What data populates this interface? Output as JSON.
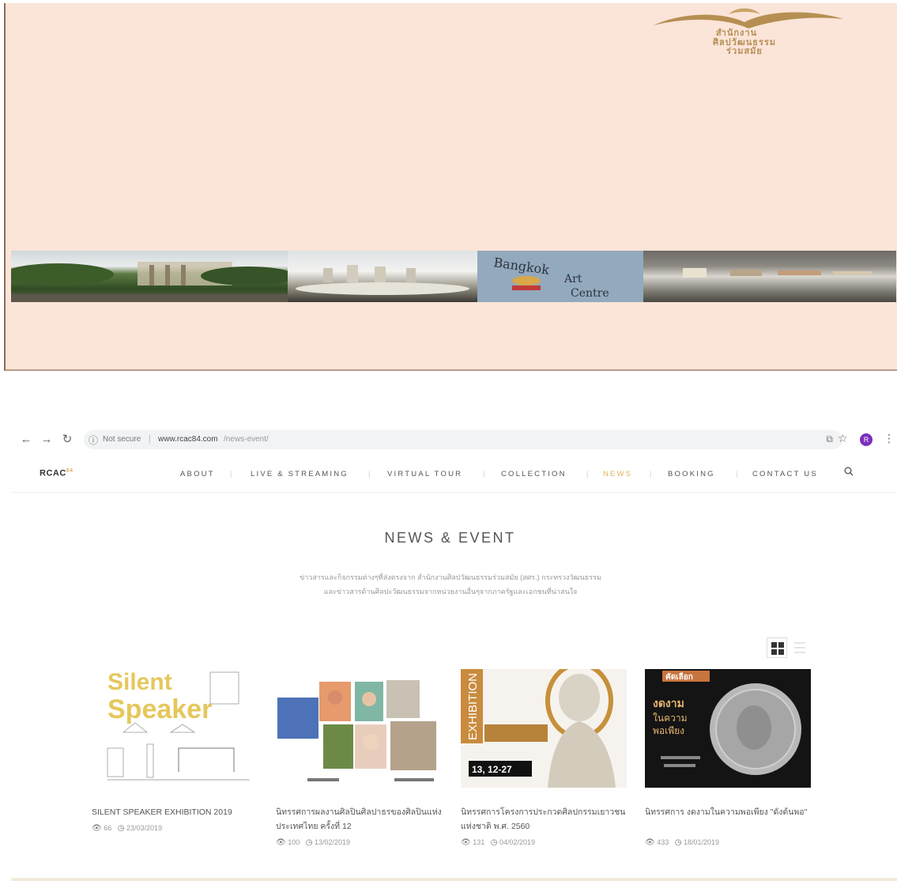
{
  "banner": {
    "logo_lines": [
      "สำนักงาน",
      "ศิลปวัฒนธรรม",
      "ร่วมสมัย"
    ],
    "logo_color": "#b58f52",
    "background": "#fbe4d8"
  },
  "browser": {
    "security": "Not secure",
    "url_domain": "www.rcac84.com",
    "url_path": "/news-event/",
    "profile_initial": "R",
    "icons": [
      "back-icon",
      "forward-icon",
      "reload-icon",
      "info-icon",
      "translate-icon",
      "star-icon",
      "kebab-icon"
    ]
  },
  "site": {
    "brand": "RCAC",
    "brand_sup": "84",
    "menu": [
      "ABOUT",
      "LIVE & STREAMING",
      "VIRTUAL TOUR",
      "COLLECTION",
      "NEWS",
      "BOOKING",
      "CONTACT US"
    ],
    "active_menu": "NEWS",
    "accent": "#e0b35a"
  },
  "page": {
    "title": "NEWS & EVENT",
    "intro_lines": [
      "ข่าวสารและกิจกรรมต่างๆที่ส่งตรงจาก สำนักงานศิลปวัฒนธรรมร่วมสมัย (สศร.) กระทรวงวัฒนธรรม",
      "และข่าวสารด้านศิลปะวัฒนธรรมจากหน่วยงานอื่นๆจากภาครัฐและเอกชนที่น่าสนใจ"
    ]
  },
  "cards": [
    {
      "title": "SILENT SPEAKER EXHIBITION 2019",
      "views": "66",
      "date": "23/03/2019"
    },
    {
      "title": "นิทรรศการผลงานศิลปินศิลปาธรของศิลปินแห่งประเทศไทย ครั้งที่ 12",
      "views": "100",
      "date": "13/02/2019"
    },
    {
      "title": "นิทรรศการโครงการประกวดศิลปกรรมเยาวชนแห่งชาติ พ.ศ. 2560",
      "views": "131",
      "date": "04/02/2019"
    },
    {
      "title": "นิทรรศการ งดงามในความพอเพียง \"ดังต้นพอ\"",
      "views": "433",
      "date": "18/01/2019"
    }
  ],
  "thumb_text": {
    "card1": [
      "Silent",
      "Speaker"
    ],
    "card3": [
      "EXHIBITION",
      "13, 12-27"
    ],
    "card4": [
      "คัดเลือก",
      "งดงาม",
      "ในความ",
      "พอเพียง"
    ]
  }
}
